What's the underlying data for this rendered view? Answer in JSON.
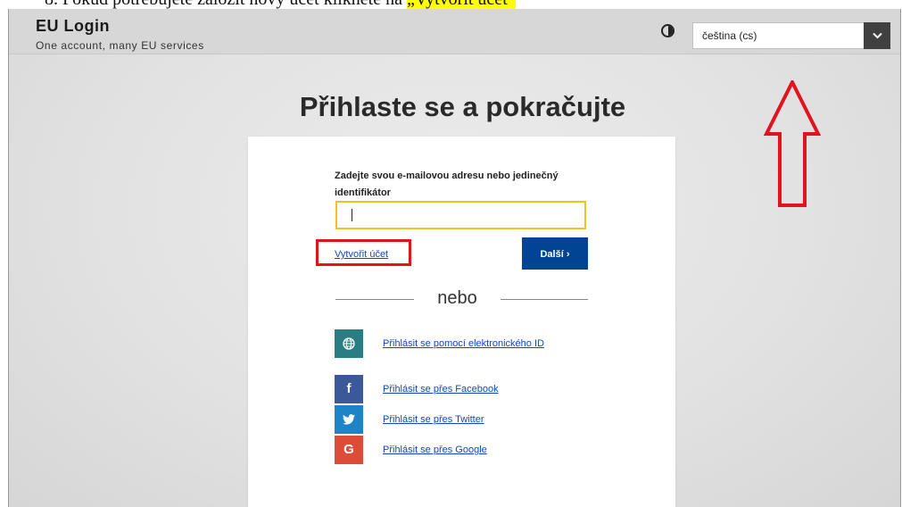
{
  "doc_caption": {
    "prefix": "8.   Pokud potřebujete založit nový účet klikněte na ",
    "highlight": "„Vytvořit účet“"
  },
  "header": {
    "title": "EU Login",
    "subtitle": "One account, many EU services",
    "language_value": "čeština (cs)",
    "contrast_icon": "contrast-icon",
    "dropdown_icon": "chevron-down-icon"
  },
  "page": {
    "title": "Přihlaste se a pokračujte"
  },
  "login": {
    "field_label": "Zadejte svou e-mailovou adresu nebo jedinečný identifikátor",
    "input_value": "",
    "create_account": "Vytvořit účet",
    "next_button": "Další ›",
    "or_text": "nebo"
  },
  "social": [
    {
      "icon": "globe-icon",
      "glyph": "",
      "color": "#2a7d82",
      "label": "Přihlásit se pomocí elektronického ID"
    },
    {
      "icon": "facebook-icon",
      "glyph": "f",
      "color": "#3b5998",
      "label": "Přihlásit se přes Facebook"
    },
    {
      "icon": "twitter-icon",
      "glyph": "",
      "color": "#1d84c8",
      "label": "Přihlásit se přes Twitter"
    },
    {
      "icon": "google-icon",
      "glyph": "G",
      "color": "#dd4b39",
      "label": "Přihlásit se přes Google"
    }
  ],
  "annotation_color": "#e3131e"
}
